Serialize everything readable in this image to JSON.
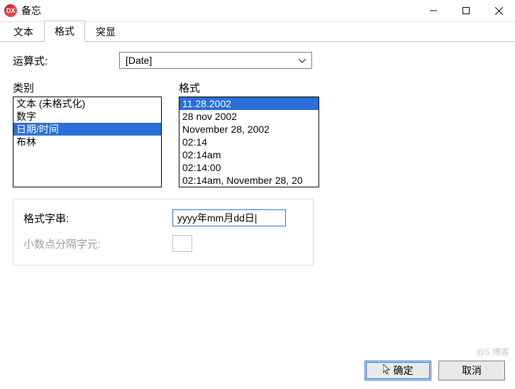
{
  "window": {
    "icon_text": "DX",
    "title": "备忘"
  },
  "tabs": {
    "t0": "文本",
    "t1": "格式",
    "t2": "突显",
    "active_index": 1
  },
  "operator": {
    "label": "运算式:",
    "value": "[Date]"
  },
  "category": {
    "label": "类别",
    "items": {
      "i0": "文本 (未格式化)",
      "i1": "数字",
      "i2": "日期/时间",
      "i3": "布林"
    },
    "selected_index": 2
  },
  "format": {
    "label": "格式",
    "items": {
      "i0": "11.28.2002",
      "i1": "28 nov 2002",
      "i2": "November 28, 2002",
      "i3": "02:14",
      "i4": "02:14am",
      "i5": "02:14:00",
      "i6": "02:14am, November 28, 20"
    },
    "selected_index": 0
  },
  "format_string": {
    "label": "格式字串:",
    "value": "yyyy年mm月dd日|"
  },
  "decimal_sep": {
    "label": "小数点分隔字元:"
  },
  "buttons": {
    "ok": "确定",
    "cancel": "取消"
  },
  "watermark": "@5     博客"
}
